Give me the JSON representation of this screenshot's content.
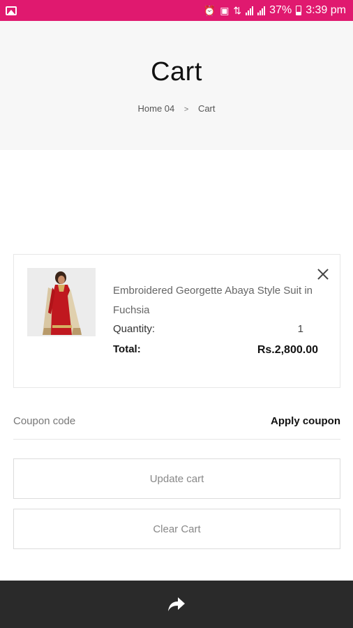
{
  "status_bar": {
    "battery": "37%",
    "time": "3:39 pm",
    "icons": [
      "image-icon",
      "alarm-icon",
      "media-icon",
      "network-icon",
      "signal-icon",
      "battery-icon"
    ]
  },
  "header": {
    "title": "Cart",
    "breadcrumb": {
      "home": "Home 04",
      "separator": ">",
      "current": "Cart"
    }
  },
  "cart_item": {
    "name": "Embroidered Georgette Abaya Style Suit in Fuchsia",
    "quantity_label": "Quantity:",
    "quantity_value": "1",
    "total_label": "Total:",
    "total_value": "Rs.2,800.00"
  },
  "coupon": {
    "placeholder": "Coupon code",
    "apply_label": "Apply coupon"
  },
  "actions": {
    "update_label": "Update cart",
    "clear_label": "Clear Cart"
  },
  "colors": {
    "status_bar": "#e0196f",
    "bottom_bar": "#2a2a2a"
  }
}
